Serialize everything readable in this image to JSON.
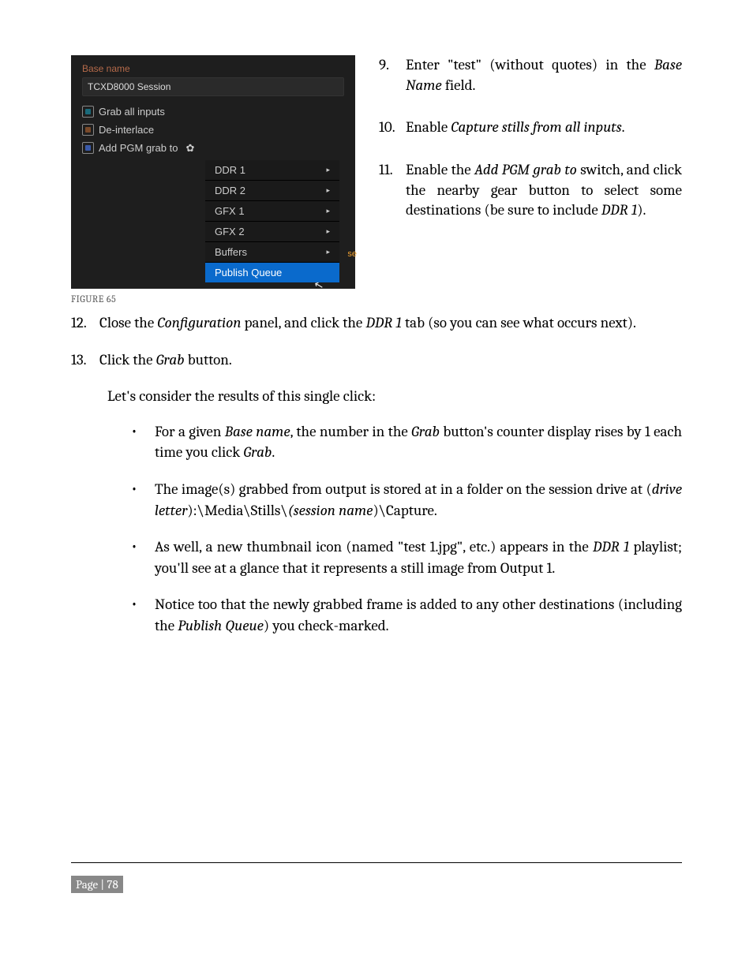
{
  "screenshot": {
    "base_name_label": "Base name",
    "base_name_value": "TCXD8000 Session",
    "grab_all_label": "Grab all inputs",
    "deinterlace_label": "De-interlace",
    "add_pgm_label": "Add PGM grab to",
    "menu": {
      "ddr1": "DDR 1",
      "ddr2": "DDR 2",
      "gfx1": "GFX 1",
      "gfx2": "GFX 2",
      "buffers": "Buffers",
      "publish_queue": "Publish Queue"
    },
    "tag": "se"
  },
  "figure_caption": "FIGURE 65",
  "steps": {
    "s9_num": "9.",
    "s9_a": "Enter \"test\" (without quotes) in the ",
    "s9_b": "Base Name",
    "s9_c": " field.",
    "s10_num": "10.",
    "s10_a": "Enable ",
    "s10_b": "Capture stills from all inputs",
    "s10_c": ".",
    "s11_num": "11.",
    "s11_a": "Enable the ",
    "s11_b": "Add PGM grab to",
    "s11_c": " switch, and click the nearby gear button to select some destinations (be sure to include ",
    "s11_d": "DDR 1",
    "s11_e": ").",
    "s12_num": "12.",
    "s12_a": "Close the ",
    "s12_b": "Configuration",
    "s12_c": " panel, and click the ",
    "s12_d": "DDR 1",
    "s12_e": " tab (so you can see what occurs next).",
    "s13_num": "13.",
    "s13_a": "Click the ",
    "s13_b": "Grab",
    "s13_c": " button.",
    "intro": "Let's consider the results of this single click:",
    "b1_a": "For a given ",
    "b1_b": "Base name",
    "b1_c": ", the number in the ",
    "b1_d": "Grab",
    "b1_e": " button's counter display rises by 1 each time you click ",
    "b1_f": "Grab",
    "b1_g": ".",
    "b2_a": "The image(s) grabbed from output is stored at in a folder on the session drive at (",
    "b2_b": "drive letter",
    "b2_c": "):\\Media\\Stills\\",
    "b2_d": "(session name",
    "b2_e": ")\\Capture.",
    "b3_a": "As well, a new thumbnail icon (named \"test 1.jpg\", etc.) appears in the ",
    "b3_b": "DDR 1",
    "b3_c": " playlist; you'll see at a glance that it represents a still image from Output 1.",
    "b4_a": "Notice too that the newly grabbed frame is added to any other destinations (including the ",
    "b4_b": "Publish Queue",
    "b4_c": ") you check-marked."
  },
  "page_num": "Page | 78"
}
